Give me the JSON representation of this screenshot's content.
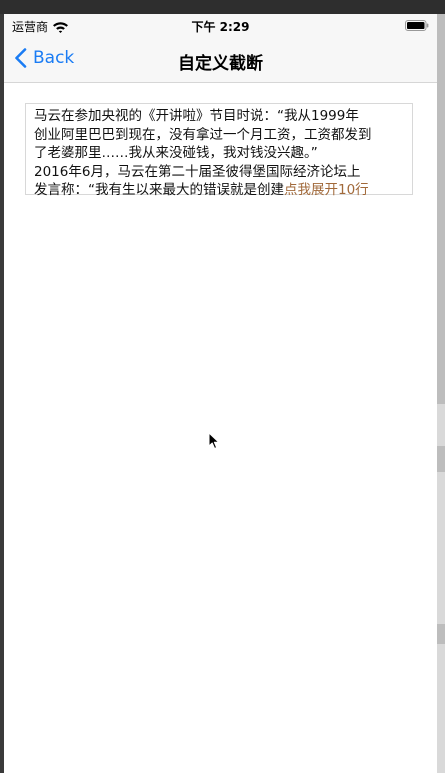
{
  "status_bar": {
    "carrier": "运营商",
    "time": "下午 2:29",
    "icons": [
      "wifi-icon",
      "battery-icon"
    ]
  },
  "nav": {
    "back_label": "Back",
    "title": "自定义截断",
    "back_icon": "chevron-left-icon"
  },
  "content": {
    "lines": [
      "马云在参加央视的《开讲啦》节目时说：“我从1999年",
      "创业阿里巴巴到现在，没有拿过一个月工资，工资都发到",
      "了老婆那里……我从来没碰钱，我对钱没兴趣。”",
      "2016年6月，马云在第二十届圣彼得堡国际经济论坛上"
    ],
    "last_line_text": "发言称：“我有生以来最大的错误就是创建",
    "expand_link": "点我展开10行"
  },
  "colors": {
    "accent": "#1a7cf4",
    "link": "#a1693a",
    "nav_background": "#f7f7f7",
    "page_background": "#ffffff",
    "outer_background": "#3a3a3a"
  }
}
